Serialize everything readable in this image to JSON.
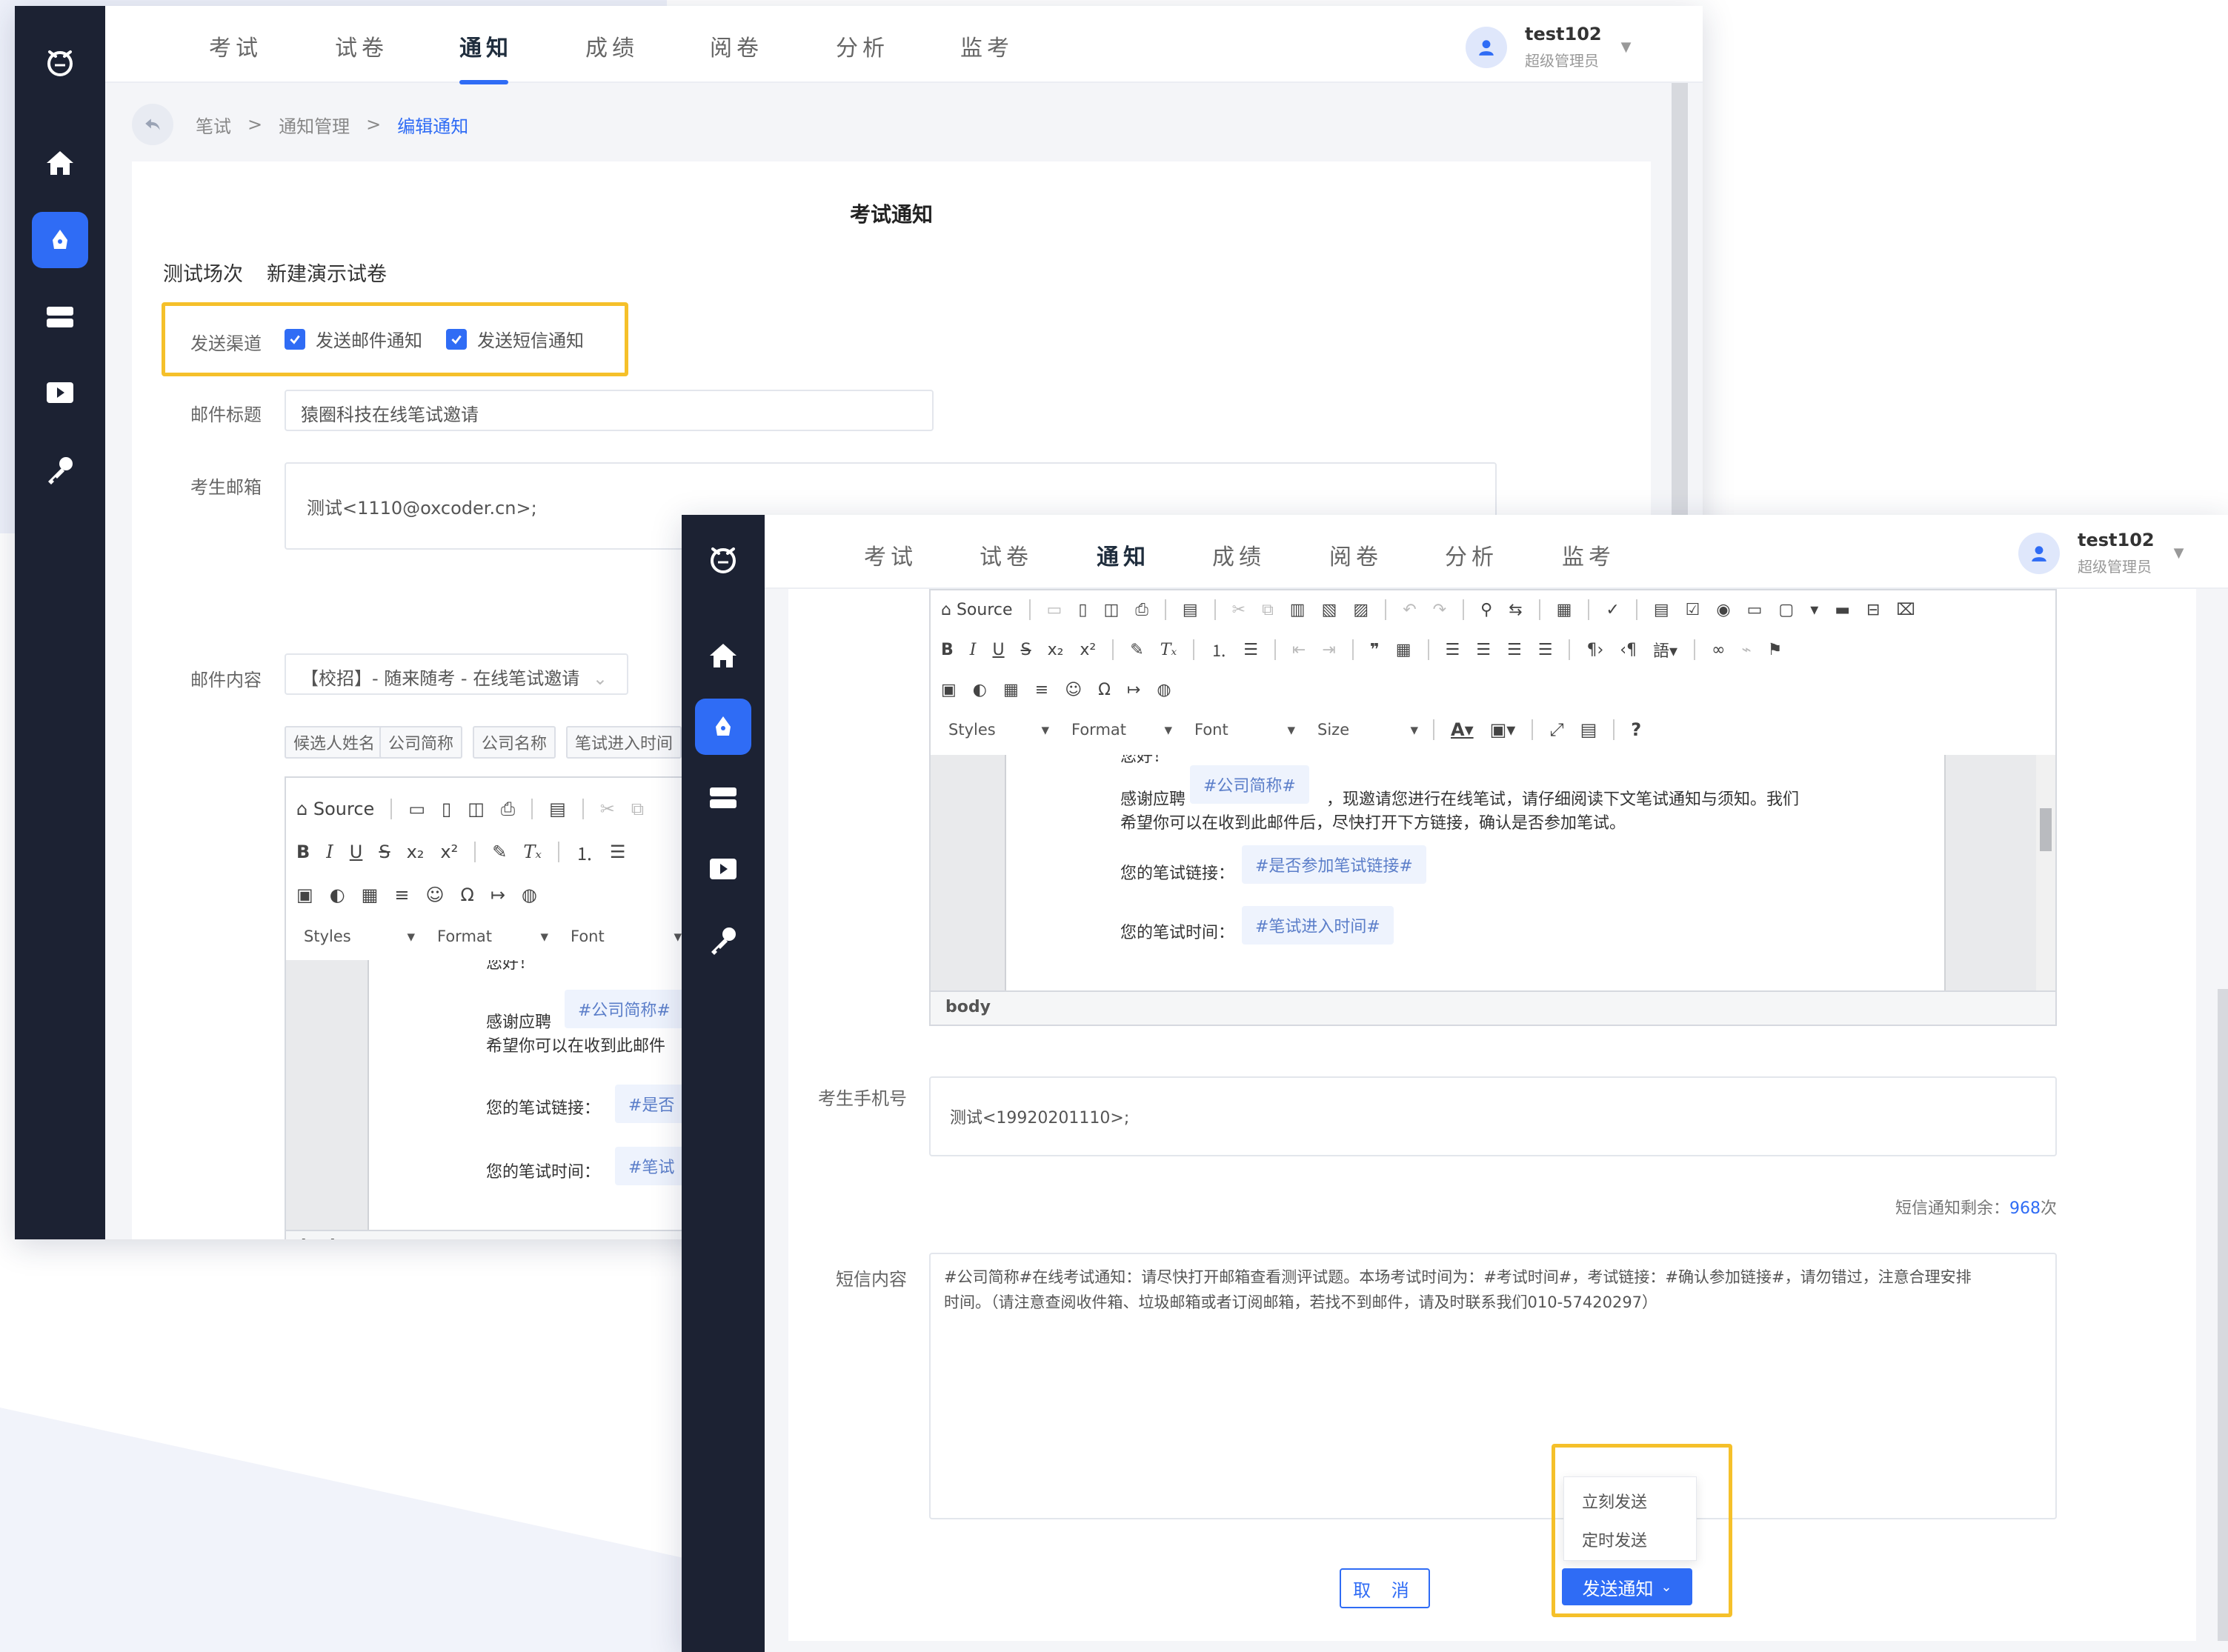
{
  "nav": {
    "tabs": [
      {
        "label": "考试"
      },
      {
        "label": "试卷"
      },
      {
        "label": "通知"
      },
      {
        "label": "成绩"
      },
      {
        "label": "阅卷"
      },
      {
        "label": "分析"
      },
      {
        "label": "监考"
      }
    ],
    "active_tab": "通知",
    "sidebar_icons": [
      "logo-icon",
      "home-icon",
      "pen-icon",
      "server-icon",
      "video-icon",
      "key-icon"
    ]
  },
  "user": {
    "name": "test102",
    "role": "超级管理员"
  },
  "breadcrumb": {
    "items": [
      "笔试",
      "通知管理",
      "编辑通知"
    ],
    "separator": ">"
  },
  "form": {
    "title": "考试通知",
    "session_label": "测试场次",
    "session_value": "新建演示试卷",
    "channel_label": "发送渠道",
    "channel_email": "发送邮件通知",
    "channel_sms": "发送短信通知",
    "email_subject_label": "邮件标题",
    "email_subject_value": "猿圈科技在线笔试邀请",
    "email_to_label": "考生邮箱",
    "email_to_value": "测试<1110@oxcoder.cn>;",
    "email_content_label": "邮件内容",
    "template_select": "【校招】- 随来随考 - 在线笔试邀请",
    "tags": [
      "候选人姓名",
      "公司简称",
      "公司名称",
      "笔试进入时间"
    ],
    "phone_label": "考生手机号",
    "phone_value": "测试<19920201110>;",
    "sms_remaining_label": "短信通知剩余：",
    "sms_remaining_count": "968",
    "sms_remaining_unit": "次",
    "sms_content_label": "短信内容",
    "sms_content_line1": "#公司简称#在线考试通知：请尽快打开邮箱查看测评试题。本场考试时间为：#考试时间#，考试链接：#确认参加链接#，请勿错过，注意合理安排",
    "sms_content_line2": "时间。（请注意查阅收件箱、垃圾邮箱或者订阅邮箱，若找不到邮件，请及时联系我们010-57420297）"
  },
  "editor": {
    "source_label": "Source",
    "styles_label": "Styles",
    "format_label": "Format",
    "font_label": "Font",
    "size_label": "Size",
    "status_path": "body",
    "greeting_fragment": "您好！",
    "thanks_prefix": "感谢应聘",
    "ph_company_short": "#公司简称#",
    "ph_company_short_cut": "#公司简称#",
    "thanks_suffix": "，现邀请您进行在线笔试，请仔细阅读下文笔试通知与须知。我们",
    "line2": "希望你可以在收到此邮件后，尽快打开下方链接，确认是否参加笔试。",
    "line2_cut": "希望你可以在收到此邮件",
    "link_label": "您的笔试链接：",
    "ph_link": "#是否参加笔试链接#",
    "ph_link_cut": "#是否",
    "time_label": "您的笔试时间：",
    "ph_time": "#笔试进入时间#",
    "ph_time_cut": "#笔试"
  },
  "actions": {
    "cancel": "取 消",
    "send": "发送通知",
    "send_options": [
      "立刻发送",
      "定时发送"
    ]
  },
  "colors": {
    "accent": "#2f6cf5",
    "sidebar": "#1c2233",
    "highlight": "#f5c02a"
  }
}
